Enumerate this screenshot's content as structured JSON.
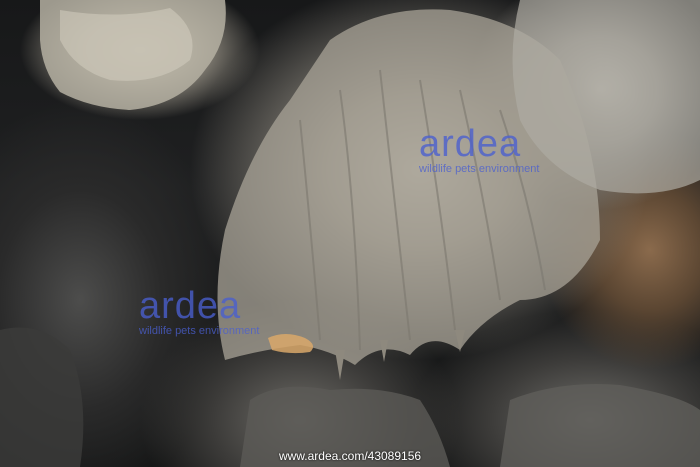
{
  "watermarks": [
    {
      "brand": "ardea",
      "tagline": "wildlife pets environment"
    },
    {
      "brand": "ardea",
      "tagline": "wildlife pets environment"
    }
  ],
  "footer": {
    "credit": "www.ardea.com/43089156"
  },
  "colors": {
    "watermark": "#4a5fd0",
    "footer_text": "#ffffff"
  }
}
